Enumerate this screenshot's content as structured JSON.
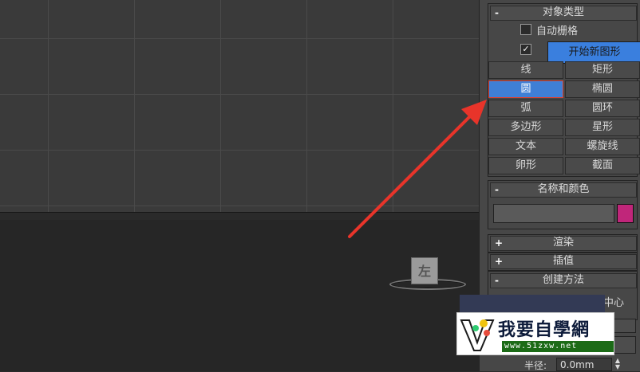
{
  "object_type": {
    "title": "对象类型",
    "collapse_sign": "-",
    "auto_grid_label": "自动栅格",
    "start_new_shape_checked": "✓",
    "start_new_shape_label": "开始新图形",
    "buttons": [
      {
        "label": "线"
      },
      {
        "label": "矩形"
      },
      {
        "label": "圆"
      },
      {
        "label": "椭圆"
      },
      {
        "label": "弧"
      },
      {
        "label": "圆环"
      },
      {
        "label": "多边形"
      },
      {
        "label": "星形"
      },
      {
        "label": "文本"
      },
      {
        "label": "螺旋线"
      },
      {
        "label": "卵形"
      },
      {
        "label": "截面"
      }
    ],
    "active_button": "圆"
  },
  "name_and_color": {
    "title": "名称和颜色",
    "collapse_sign": "-",
    "name_value": "",
    "color": "#c0267a"
  },
  "rendering": {
    "title": "渲染",
    "sign": "+"
  },
  "interpolation": {
    "title": "插值",
    "sign": "+"
  },
  "creation_method": {
    "title": "创建方法",
    "sign": "-",
    "partial_option": "中心"
  },
  "parameters": {
    "radius_label": "半径:",
    "radius_value": "0.0mm"
  },
  "viewcube": {
    "label": "左"
  },
  "watermark": {
    "title": "我要自學網",
    "url": "www.51zxw.net"
  },
  "colors": {
    "accent": "#3f7fd6",
    "highlight_border": "#e0402c",
    "arrow": "#e8342a"
  }
}
